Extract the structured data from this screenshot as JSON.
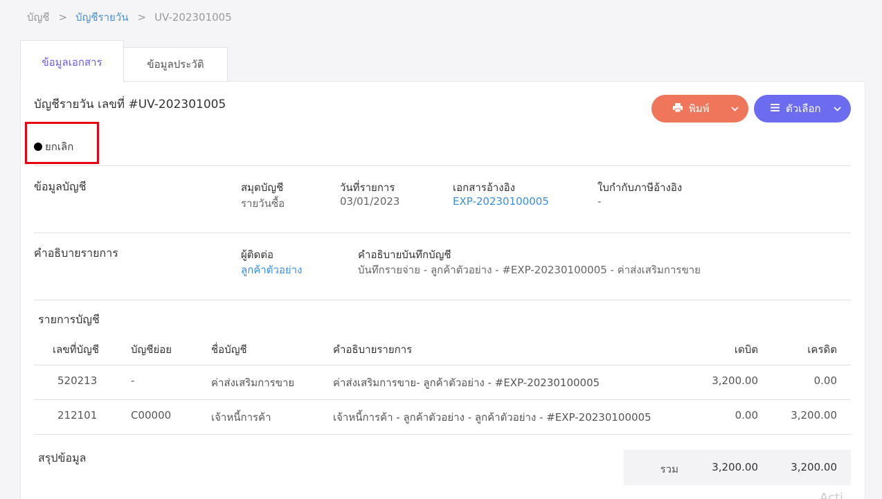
{
  "breadcrumb": {
    "root": "บัญชี",
    "sep1": ">",
    "section": "บัญชีรายวัน",
    "sep2": ">",
    "current": "UV-202301005"
  },
  "tabs": {
    "doc_info": "ข้อมูลเอกสาร",
    "history": "ข้อมูลประวัติ"
  },
  "header": {
    "title": "บัญชีรายวัน เลขที่ #UV-202301005",
    "print_label": "พิมพ์",
    "options_label": "ตัวเลือก",
    "status": "ยกเลิก"
  },
  "account_info": {
    "section_title": "ข้อมูลบัญชี",
    "book_label": "สมุดบัญชี",
    "book_value": "รายวันซื้อ",
    "date_label": "วันที่รายการ",
    "date_value": "03/01/2023",
    "ref_doc_label": "เอกสารอ้างอิง",
    "ref_doc_value": "EXP-20230100005",
    "tax_ref_label": "ใบกำกับภาษีอ้างอิง",
    "tax_ref_value": "-"
  },
  "description": {
    "section_title": "คำอธิบายรายการ",
    "contact_label": "ผู้ติดต่อ",
    "contact_value": "ลูกค้าตัวอย่าง",
    "note_label": "คำอธิบายบันทึกบัญชี",
    "note_value": "บันทึกรายจ่าย - ลูกค้าตัวอย่าง - #EXP-20230100005 - ค่าส่งเสริมการขาย"
  },
  "entries": {
    "section_title": "รายการบัญชี",
    "columns": {
      "account_no": "เลขที่บัญชี",
      "sub_account": "บัญชีย่อย",
      "account_name": "ชื่อบัญชี",
      "description": "คำอธิบายรายการ",
      "debit": "เดบิต",
      "credit": "เครดิต"
    },
    "rows": [
      {
        "account_no": "520213",
        "sub_account": "-",
        "account_name": "ค่าส่งเสริมการขาย",
        "description": "ค่าส่งเสริมการขาย- ลูกค้าตัวอย่าง - #EXP-20230100005",
        "debit": "3,200.00",
        "credit": "0.00"
      },
      {
        "account_no": "212101",
        "sub_account": "C00000",
        "account_name": "เจ้าหนี้การค้า",
        "description": "เจ้าหนี้การค้า - ลูกค้าตัวอย่าง - ลูกค้าตัวอย่าง - #EXP-20230100005",
        "debit": "0.00",
        "credit": "3,200.00"
      }
    ]
  },
  "summary": {
    "section_title": "สรุปข้อมูล",
    "total_label": "รวม",
    "total_debit": "3,200.00",
    "total_credit": "3,200.00"
  },
  "watermark": "Acti"
}
